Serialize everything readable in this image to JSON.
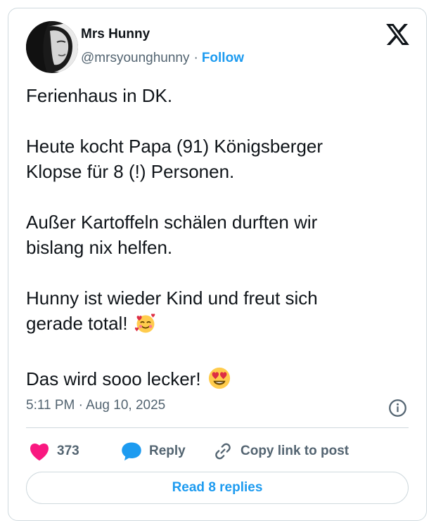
{
  "author": {
    "display_name": "Mrs Hunny",
    "handle": "@mrsyounghunny",
    "separator": "·",
    "follow_label": "Follow"
  },
  "brand": {
    "logo_icon": "x-logo-icon"
  },
  "tweet": {
    "lines": {
      "l1": "Ferienhaus in DK.",
      "l2": "Heute kocht Papa (91) Königsberger",
      "l3": "Klopse für 8 (!) Personen.",
      "l4": "Außer Kartoffeln schälen durften wir",
      "l5": "bislang nix helfen.",
      "l6": "Hunny ist wieder Kind und freut sich",
      "l7": "gerade total!",
      "l8": "Das wird sooo lecker!"
    },
    "emojis": {
      "smiling_hearts": "smiling-face-with-hearts-emoji",
      "heart_eyes": "heart-eyes-emoji"
    },
    "timestamp": "5:11 PM · Aug 10, 2025"
  },
  "actions": {
    "like_count": "373",
    "reply_label": "Reply",
    "copy_label": "Copy link to post"
  },
  "footer": {
    "read_replies_label": "Read 8 replies"
  },
  "colors": {
    "accent": "#1d9bf0",
    "like": "#f91880",
    "text": "#0f1419",
    "muted": "#536471",
    "border": "#cfd9de"
  }
}
